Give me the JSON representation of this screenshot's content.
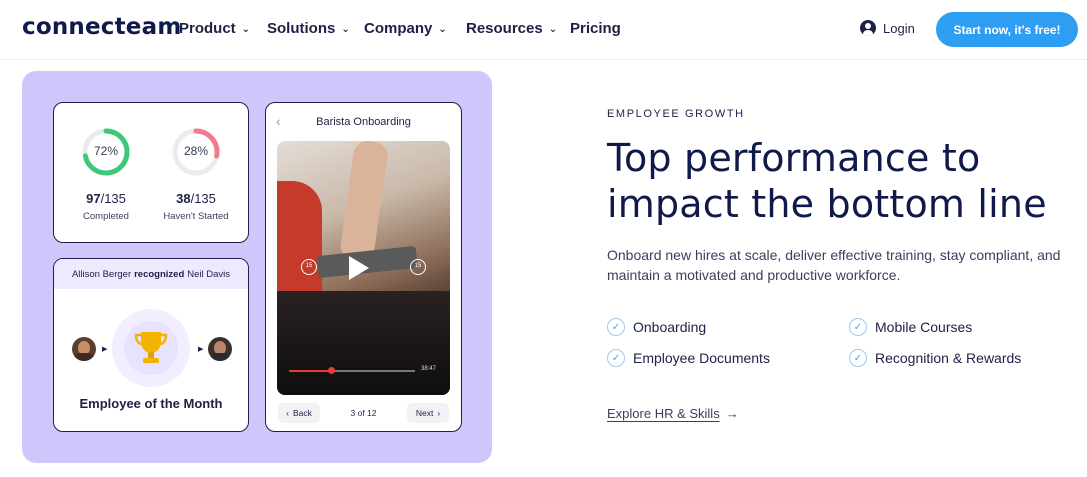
{
  "nav": {
    "logo": "connecteam",
    "items": [
      {
        "label": "Product",
        "icon": "chevron-down-icon"
      },
      {
        "label": "Solutions",
        "icon": "chevron-down-icon"
      },
      {
        "label": "Company",
        "icon": "chevron-down-icon"
      },
      {
        "label": "Resources",
        "icon": "chevron-down-icon"
      },
      {
        "label": "Pricing"
      }
    ],
    "login_label": "Login",
    "cta_label": "Start now, it's free!"
  },
  "illustration": {
    "stats": {
      "completed_pct_label": "72%",
      "completed_pct": 72,
      "completed_count": "97",
      "total_a": "/135",
      "completed_caption": "Completed",
      "not_started_pct_label": "28%",
      "not_started_pct": 28,
      "not_started_count": "38",
      "total_b": "/135",
      "not_started_caption": "Haven't Started"
    },
    "recognition": {
      "giver": "Allison Berger",
      "verb": "recognized",
      "receiver": "Neil Davis",
      "award": "Employee of the Month"
    },
    "video": {
      "title": "Barista Onboarding",
      "time": "38:47",
      "progress": 0.33,
      "back_label": "Back",
      "page_label": "3 of 12",
      "next_label": "Next"
    }
  },
  "content": {
    "eyebrow": "EMPLOYEE GROWTH",
    "headline_line1": "Top performance to",
    "headline_line2": "impact the bottom line",
    "lead": "Onboard new hires at scale, deliver effective training, stay compliant, and maintain a motivated and productive workforce.",
    "features": [
      "Onboarding",
      "Mobile Courses",
      "Employee Documents",
      "Recognition & Rewards"
    ],
    "explore_label": "Explore HR & Skills"
  },
  "colors": {
    "accent": "#2e9ef2",
    "panel": "#cfc6fb",
    "navy": "#0f1a4a",
    "completed_ring": "#3ec97a",
    "not_started_ring": "#f27c8a"
  }
}
